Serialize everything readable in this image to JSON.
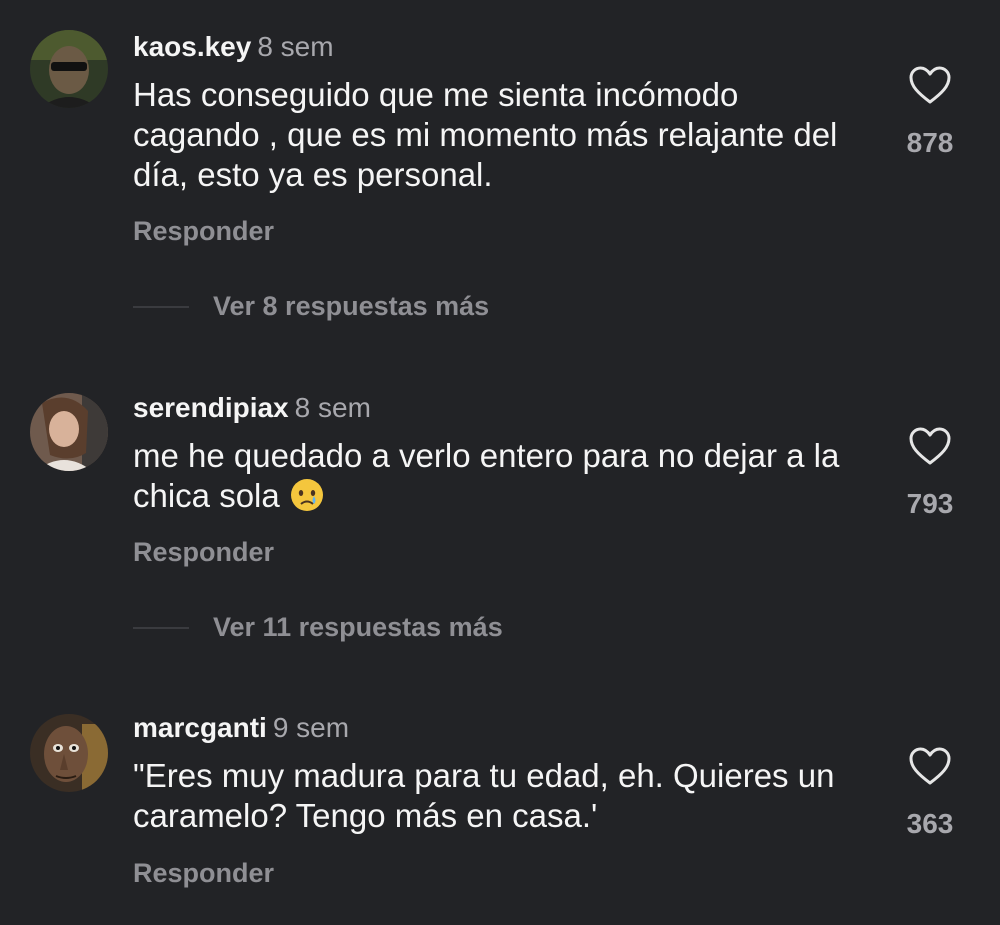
{
  "comments": [
    {
      "username": "kaos.key",
      "age": "8 sem",
      "text": "Has conseguido que me sienta incómodo cagando , que es mi momento más relajante del día, esto ya es personal.",
      "reply_label": "Responder",
      "likes": "878",
      "avatar_icon": "avatar-green-man-sunglasses",
      "more_replies": "Ver 8 respuestas más"
    },
    {
      "username": "serendipiax",
      "age": "8 sem",
      "text": "me he quedado a verlo entero para no dejar a la chica sola",
      "emoji": "crying-face",
      "reply_label": "Responder",
      "likes": "793",
      "avatar_icon": "avatar-woman-photo",
      "more_replies": "Ver 11 respuestas más"
    },
    {
      "username": "marcganti",
      "age": "9 sem",
      "text": "\"Eres muy madura para tu edad, eh. Quieres un caramelo? Tengo más en casa.'",
      "reply_label": "Responder",
      "likes": "363",
      "avatar_icon": "avatar-puppet-face"
    }
  ],
  "colors": {
    "background": "#222326",
    "text_primary": "#f5f5f5",
    "text_secondary": "#a8a8ad",
    "text_muted": "#8f8f94"
  }
}
